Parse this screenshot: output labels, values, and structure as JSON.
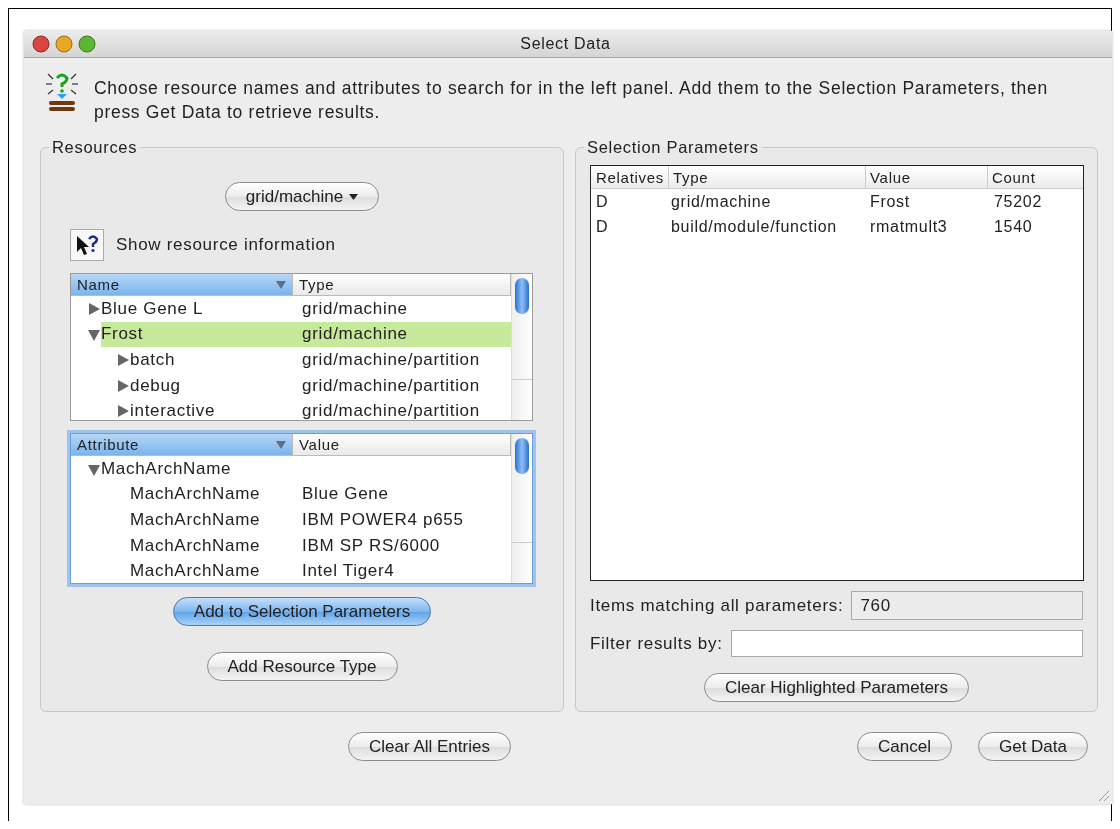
{
  "window": {
    "title": "Select Data"
  },
  "intro": {
    "text": "Choose resource names and attributes to search for in the left panel.  Add them to the Selection Parameters, then press Get Data to retrieve results."
  },
  "resources": {
    "title": "Resources",
    "type_menu": {
      "label": "grid/machine"
    },
    "info": {
      "label": "Show resource information"
    },
    "tree": {
      "focused": false,
      "columns": [
        {
          "label": "Name",
          "sorted": true
        },
        {
          "label": "Type",
          "sorted": false
        }
      ],
      "items": [
        {
          "cells": [
            "Blue Gene L",
            "grid/machine"
          ],
          "expanded": false,
          "selected": false
        },
        {
          "cells": [
            "Frost",
            "grid/machine"
          ],
          "expanded": true,
          "selected": true,
          "children": [
            {
              "cells": [
                "batch",
                "grid/machine/partition"
              ],
              "expanded": false,
              "selected": false
            },
            {
              "cells": [
                "debug",
                "grid/machine/partition"
              ],
              "expanded": false,
              "selected": false
            },
            {
              "cells": [
                "interactive",
                "grid/machine/partition"
              ],
              "expanded": false,
              "selected": false
            }
          ]
        }
      ]
    },
    "attributes": {
      "focused": true,
      "columns": [
        {
          "label": "Attribute",
          "sorted": true
        },
        {
          "label": "Value",
          "sorted": false
        }
      ],
      "items": [
        {
          "cells": [
            "MachArchName"
          ],
          "expanded": true,
          "selected": false,
          "children": [
            {
              "cells": [
                "MachArchName",
                "Blue Gene"
              ],
              "selected": false
            },
            {
              "cells": [
                "MachArchName",
                "IBM POWER4 p655"
              ],
              "selected": false
            },
            {
              "cells": [
                "MachArchName",
                "IBM SP RS/6000"
              ],
              "selected": false
            },
            {
              "cells": [
                "MachArchName",
                "Intel Tiger4"
              ],
              "selected": false
            }
          ]
        }
      ]
    },
    "buttons": [
      {
        "label": "Add to Selection Parameters",
        "default": true
      },
      {
        "label": "Add Resource Type",
        "default": false
      }
    ]
  },
  "selection": {
    "title": "Selection Parameters",
    "columns": [
      "Relatives",
      "Type",
      "Value",
      "Count"
    ],
    "rows": [
      [
        "D",
        "grid/machine",
        "Frost",
        "75202"
      ],
      [
        "D",
        "build/module/function",
        "rmatmult3",
        "1540"
      ]
    ],
    "matching": {
      "label": "Items matching all parameters:",
      "value": "760"
    },
    "filter": {
      "label": "Filter results by:"
    },
    "button": {
      "label": "Clear Highlighted Parameters"
    }
  },
  "footer": {
    "left": [
      {
        "label": "Clear All Entries"
      }
    ],
    "right": [
      {
        "label": "Cancel"
      },
      {
        "label": "Get Data"
      }
    ]
  }
}
